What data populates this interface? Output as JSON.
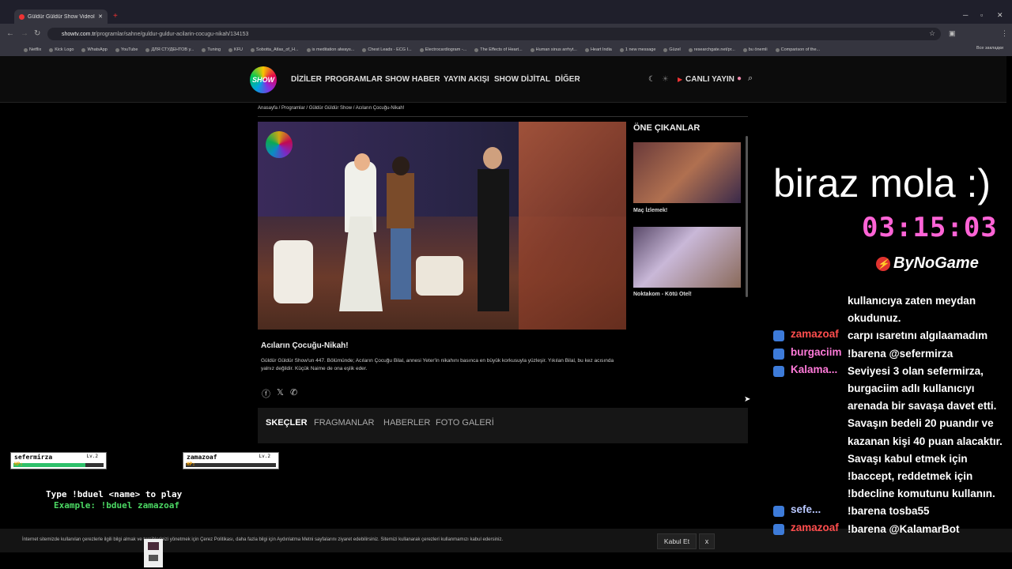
{
  "browser": {
    "tab_title": "Güldür Güldür Show Videoları",
    "url_domain": "showtv.com.tr",
    "url_path": "/programlar/sahne/guldur-guldur-acilarin-cocugu-nikah/134153",
    "bookmarks": [
      "Netflix",
      "Kick Logo",
      "WhatsApp",
      "YouTube",
      "ДЛЯ СТУДЕНТОВ у...",
      "Tuning",
      "KFU",
      "Sobotta_Atlas_of_H...",
      "is meditation always...",
      "Chest Leads - ECG I...",
      "Electrocardiogram -...",
      "The Effects of Heart...",
      "Human sinus arrhyt...",
      "Heart India",
      "1 new message",
      "Güzel",
      "researchgate.net/pr...",
      "bu önemli",
      "Comparison of the..."
    ],
    "bookmarks_other": "Все закладки"
  },
  "site": {
    "logo": "SHOW",
    "nav": [
      "DİZİLER",
      "PROGRAMLAR",
      "SHOW HABER",
      "YAYIN AKIŞI",
      "SHOW DİJİTAL",
      "DİĞER"
    ],
    "live": "CANLI YAYIN",
    "breadcrumb": "Anasayfa / Programlar / Güldür Güldür Show / Acıların Çocuğu-Nikah!",
    "featured_title": "ÖNE ÇIKANLAR",
    "featured": [
      {
        "caption": "Maç İzlemek!"
      },
      {
        "caption": "Noktakom - Kötü Otel!"
      }
    ],
    "episode_title": "Acıların Çocuğu-Nikah!",
    "episode_desc": "Güldür Güldür Show'un 447. Bölümünde; Acıların Çocuğu Bilal, annesi Yeter'in nikahını basınca en büyük korkusuyla yüzleşir. Yıkılan Bilal, bu kez acısında yalnız değildir. Küçük Naime de ona eşlik eder.",
    "tabs": [
      "SKEÇLER",
      "FRAGMANLAR",
      "HABERLER",
      "FOTO GALERİ"
    ],
    "cookie_text": "İnternet sitemizde kullanılan çerezlerle ilgili bilgi almak ve tercihlerinizi yönetmek için Çerez Politikası, daha fazla bilgi için Aydınlatma Metni sayfalarını ziyaret edebilirsiniz. Sitemizi kullanarak çerezleri kullanmamızı kabul edersiniz.",
    "cookie_accept": "Kabul Et",
    "cookie_close": "x"
  },
  "game": {
    "player1": {
      "name": "sefermirza",
      "level": "Lv.2",
      "hp_label": "HP:",
      "hp": 0.8
    },
    "player2": {
      "name": "zamazoaf",
      "level": "Lv.2",
      "hp_label": "HP:",
      "hp": 0.0
    },
    "instruction": "Type !bduel <name> to play",
    "example": "Example: !bduel zamazoaf"
  },
  "stream": {
    "break_text": "biraz mola :)",
    "timer": "03:15:03",
    "brand": "ByNoGame",
    "chat": [
      {
        "user": "",
        "msg": "kullanıcıya zaten meydan"
      },
      {
        "user": "",
        "msg": "okudunuz."
      },
      {
        "user": "zamazoaf",
        "color": "#ff4d4d",
        "msg": "carpı ısaretını algılaamadım"
      },
      {
        "user": "burgaciim",
        "color": "#ff7ad9",
        "msg": "!barena @sefermirza"
      },
      {
        "user": "Kalama...",
        "color": "#ff7ad9",
        "msg": "Seviyesi 3 olan sefermirza,"
      },
      {
        "user": "",
        "msg": "burgaciim adlı kullanıcıyı"
      },
      {
        "user": "",
        "msg": "arenada bir savaşa davet etti."
      },
      {
        "user": "",
        "msg": "Savaşın bedeli 20 puandır ve"
      },
      {
        "user": "",
        "msg": "kazanan kişi 40 puan alacaktır."
      },
      {
        "user": "",
        "msg": "Savaşı kabul etmek için"
      },
      {
        "user": "",
        "msg": "!baccept, reddetmek için"
      },
      {
        "user": "",
        "msg": "!bdecline komutunu kullanın."
      },
      {
        "user": "sefe...",
        "color": "#b9c8ff",
        "msg": "!barena tosba55"
      },
      {
        "user": "zamazoaf",
        "color": "#ff4d4d",
        "msg": "!barena @KalamarBot"
      }
    ]
  }
}
